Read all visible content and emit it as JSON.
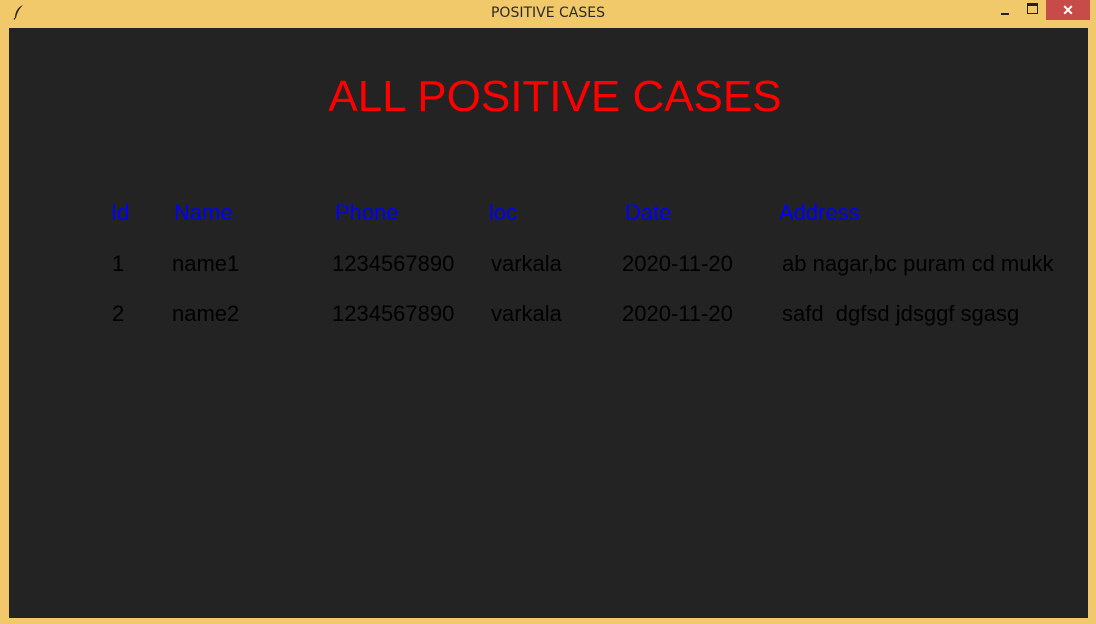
{
  "window": {
    "title": "POSITIVE CASES",
    "icon": "feather-icon",
    "controls": {
      "minimize": "minimize-icon",
      "maximize": "maximize-icon",
      "close": "✕"
    }
  },
  "heading": "ALL POSITIVE CASES",
  "table": {
    "columns": [
      "Id",
      "Name",
      "Phone",
      "loc",
      "Date",
      "Address"
    ],
    "rows": [
      [
        "1",
        "name1",
        "1234567890",
        "varkala",
        "2020-11-20",
        "ab nagar,bc puram cd mukk"
      ],
      [
        "2",
        "name2",
        "1234567890",
        "varkala",
        "2020-11-20",
        "safd  dgfsd jdsggf sgasg"
      ]
    ]
  },
  "colors": {
    "frame": "#f1c86a",
    "background": "#232323",
    "heading": "#ff0000",
    "column_header": "#0000ff",
    "cell_text": "#000000",
    "close_button": "#c74b48"
  }
}
